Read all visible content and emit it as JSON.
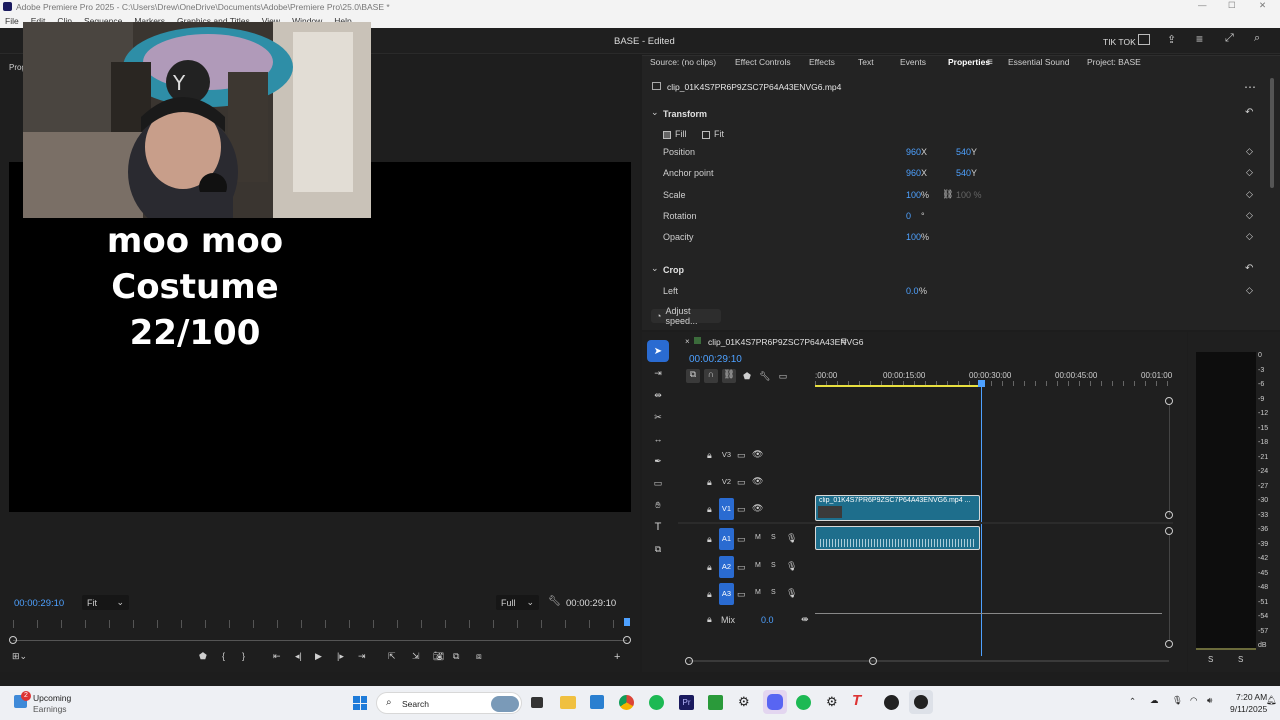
{
  "window": {
    "title": "Adobe Premiere Pro 2025 - C:\\Users\\Drew\\OneDrive\\Documents\\Adobe\\Premiere Pro\\25.0\\BASE *"
  },
  "menu": [
    "File",
    "Edit",
    "Clip",
    "Sequence",
    "Markers",
    "Graphics and Titles",
    "View",
    "Window",
    "Help"
  ],
  "app": {
    "doc_title": "BASE - Edited",
    "workspace": "TIK TOK",
    "left_tab_fragment": "Prog"
  },
  "overlay": {
    "line1": "moo moo Costume",
    "line2": "22/100"
  },
  "program": {
    "timecode_left": "00:00:29:10",
    "fit": "Fit",
    "quality": "Full",
    "timecode_right": "00:00:29:10"
  },
  "tabs": [
    "Source: (no clips)",
    "Effect Controls",
    "Effects",
    "Text",
    "Events",
    "Properties",
    "Essential Sound",
    "Project: BASE"
  ],
  "properties": {
    "clip_name": "clip_01K4S7PR6P9ZSC7P64A43ENVG6.mp4",
    "transform_label": "Transform",
    "fill": "Fill",
    "fit": "Fit",
    "rows": [
      {
        "label": "Position",
        "v1": "960",
        "u1": "X",
        "v2": "540",
        "u2": "Y"
      },
      {
        "label": "Anchor point",
        "v1": "960",
        "u1": "X",
        "v2": "540",
        "u2": "Y"
      },
      {
        "label": "Scale",
        "v1": "100",
        "u1": "%",
        "v2": "100 %",
        "u2": ""
      },
      {
        "label": "Rotation",
        "v1": "0",
        "u1": "°",
        "v2": "",
        "u2": ""
      },
      {
        "label": "Opacity",
        "v1": "100",
        "u1": "%",
        "v2": "",
        "u2": ""
      }
    ],
    "crop_label": "Crop",
    "left_label": "Left",
    "left_val": "0.0",
    "left_unit": "%",
    "adjust": "Adjust speed..."
  },
  "timeline": {
    "seq_name": "clip_01K4S7PR6P9ZSC7P64A43ENVG6",
    "timecode": "00:00:29:10",
    "ruler": [
      ":00:00",
      "00:00:15:00",
      "00:00:30:00",
      "00:00:45:00",
      "00:01:00"
    ],
    "tracks_v": [
      "V3",
      "V2",
      "V1"
    ],
    "tracks_a": [
      "A1",
      "A2",
      "A3"
    ],
    "mix_label": "Mix",
    "mix_val": "0.0",
    "clip_label": "clip_01K4S7PR6P9ZSC7P64A43ENVG6.mp4 ..."
  },
  "meter": {
    "scale": [
      "0",
      "-3",
      "-6",
      "-9",
      "-12",
      "-15",
      "-18",
      "-21",
      "-24",
      "-27",
      "-30",
      "-33",
      "-36",
      "-39",
      "-42",
      "-45",
      "-48",
      "-51",
      "-54",
      "-57",
      "dB"
    ],
    "solo": [
      "S",
      "S"
    ]
  },
  "taskbar": {
    "weather_title": "Upcoming",
    "weather_sub": "Earnings",
    "search": "Search",
    "time": "7:20 AM",
    "date": "9/11/2025",
    "badge": "2"
  },
  "colors": {
    "accent": "#4ea1ff",
    "clip": "#1e6e8c",
    "track_active": "#2a6bd1"
  }
}
